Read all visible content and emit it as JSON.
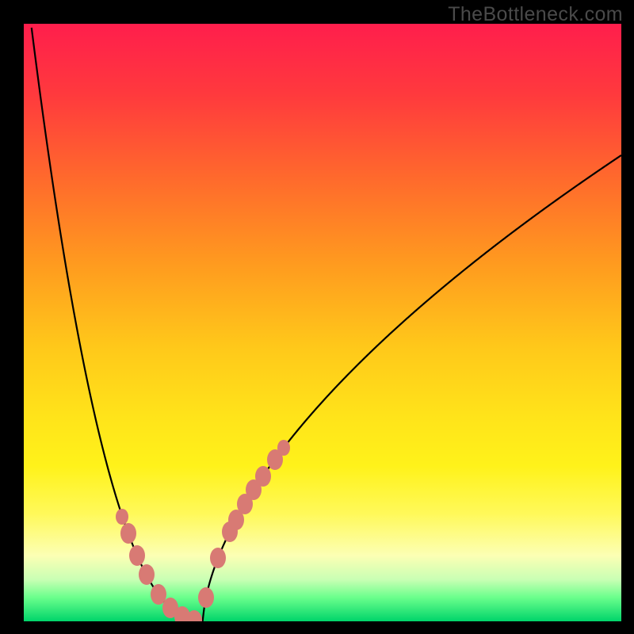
{
  "watermark": "TheBottleneck.com",
  "colors": {
    "curve_stroke": "#000000",
    "marker_fill": "#d87a74",
    "frame_border": "#000000"
  },
  "chart_data": {
    "type": "line",
    "title": "",
    "xlabel": "",
    "ylabel": "",
    "curve": {
      "description": "Bottleneck penalty curve; x in [0,1] is relative hardware balance, y is normalized penalty (0 = optimal, 1 = worst). Minimum near x≈0.30.",
      "x_min": 0.0,
      "x_opt": 0.3,
      "x_max": 1.0,
      "y_at_x_min": 1.1,
      "y_at_x_opt": 0.0,
      "y_at_x_max": 0.78,
      "left_shape_exponent": 2.3,
      "right_shape_exponent": 0.6
    },
    "markers_on_curve_x": [
      0.165,
      0.175,
      0.19,
      0.205,
      0.225,
      0.245,
      0.265,
      0.285,
      0.305,
      0.325,
      0.345,
      0.355,
      0.37,
      0.385,
      0.4,
      0.42,
      0.435
    ],
    "marker_small_indices": [
      0,
      16
    ]
  }
}
